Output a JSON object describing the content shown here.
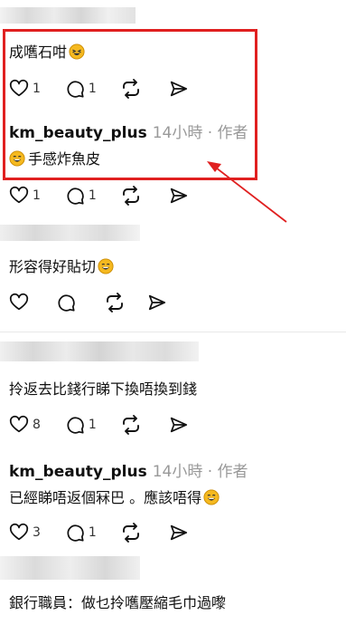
{
  "colors": {
    "highlight": "#e02020",
    "meta": "#999999",
    "text": "#111111"
  },
  "comments": [
    {
      "text": "成嚿石咁",
      "emoji": "squinting-laugh-emoji",
      "likes": "1",
      "replies": "1"
    },
    {
      "username": "km_beauty_plus",
      "meta": "14小時 · 作者",
      "text": "手感炸魚皮",
      "emoji_lead": "laugh-emoji",
      "likes": "1",
      "replies": "1"
    },
    {
      "text": "形容得好貼切",
      "emoji": "laugh-emoji",
      "likes": "",
      "replies": ""
    },
    {
      "text": "拎返去比錢行睇下換唔換到錢",
      "likes": "8",
      "replies": "1"
    },
    {
      "username": "km_beauty_plus",
      "meta": "14小時 · 作者",
      "text": "已經睇唔返個冧巴 。應該唔得",
      "emoji": "laugh-emoji",
      "likes": "3",
      "replies": "1"
    },
    {
      "text": "銀行職員：做乜拎嚿壓縮毛巾過嚟"
    }
  ],
  "icons": {
    "like": "heart-icon",
    "reply": "comment-icon",
    "repost": "repost-icon",
    "share": "share-icon"
  }
}
